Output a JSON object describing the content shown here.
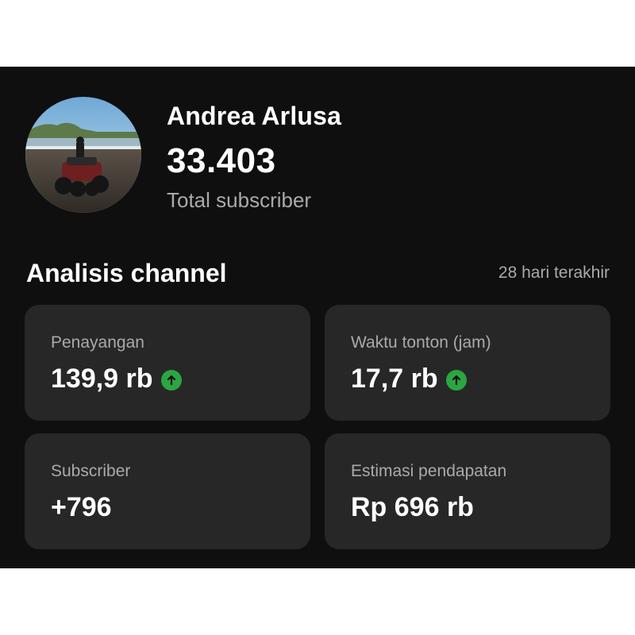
{
  "channel": {
    "name": "Andrea Arlusa",
    "subscriber_count": "33.403",
    "subscriber_label": "Total subscriber",
    "avatar_icon": "channel-avatar-photo"
  },
  "analytics": {
    "title": "Analisis channel",
    "period": "28 hari terakhir",
    "cards": [
      {
        "label": "Penayangan",
        "value": "139,9 rb",
        "trend": "up"
      },
      {
        "label": "Waktu tonton (jam)",
        "value": "17,7 rb",
        "trend": "up"
      },
      {
        "label": "Subscriber",
        "value": "+796",
        "trend": null
      },
      {
        "label": "Estimasi pendapatan",
        "value": "Rp 696 rb",
        "trend": null
      }
    ]
  },
  "colors": {
    "background": "#0f0f0f",
    "card": "#272727",
    "text_primary": "#ffffff",
    "text_secondary": "#aaaaaa",
    "trend_up": "#2ba640"
  }
}
